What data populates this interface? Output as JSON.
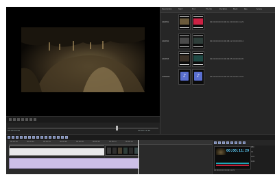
{
  "viewer": {
    "time_left": "00:00:00:00",
    "time_right": "00:00:11:29"
  },
  "bin": {
    "columns": [
      "Description",
      "Start",
      "End",
      "Thumb",
      "Duration",
      "Mark",
      "Res",
      "Scene"
    ],
    "rows": [
      {
        "name": "CAVE01",
        "meta": "00:00:00:00  00:00:11:29  00:00:11:29",
        "thumb_type": "video",
        "thumb_color": "#6b5a3b"
      },
      {
        "name": "CAVE02",
        "meta": "00:00:00:00  00:00:08:12  00:00:08:12",
        "thumb_type": "video",
        "thumb_color": "#4a4a4a"
      },
      {
        "name": "CAVE03",
        "meta": "00:00:00:00  00:00:06:05  00:00:06:05",
        "thumb_type": "video",
        "thumb_color": "#3a3026"
      },
      {
        "name": "AUDIO01",
        "meta": "00:00:00:00  00:00:13:02  00:00:13:02",
        "thumb_type": "audio",
        "thumb_color": "#5a6fd0"
      }
    ]
  },
  "timeline": {
    "ruler_labels": [
      "00:00:00",
      "00:00:02",
      "00:00:04",
      "00:00:06",
      "00:00:08",
      "00:00:10",
      "00:00:12",
      "00:00:14"
    ]
  },
  "right_panel": {
    "timecode": "00:00:11:29",
    "side_labels": [
      "REC",
      "IN",
      "OUT",
      "DUR"
    ],
    "bottom_text": "00:00:00:00   00:00:11:29"
  },
  "colors": {
    "accent": "#5fd3ff",
    "audio_track": "#ccbfe7",
    "teal": "#1aa8b8",
    "red": "#c0213a"
  }
}
